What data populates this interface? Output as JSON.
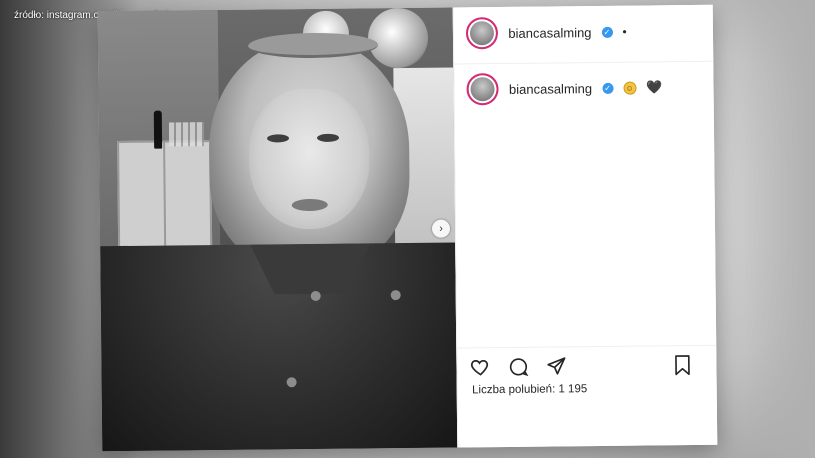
{
  "overlay": {
    "source_text": "źródło: instagram.com/biancasalming"
  },
  "post": {
    "author": {
      "username": "biancasalming",
      "verified": true,
      "header_dot": "•"
    },
    "caption": {
      "username": "biancasalming",
      "emojis": [
        "smiling-face-emoji",
        "black-heart-emoji"
      ],
      "heart_glyph": "🖤",
      "smile_glyph": "☺"
    },
    "carousel": {
      "next_icon": "chevron-right-icon",
      "glyph": "›"
    },
    "actions": {
      "like_icon": "heart-outline-icon",
      "comment_icon": "comment-bubble-icon",
      "share_icon": "paper-plane-icon",
      "save_icon": "bookmark-icon"
    },
    "likes_text": "Liczba polubień: 1 195"
  },
  "colors": {
    "verified": "#3897f0",
    "avatar_ring": "#d62976",
    "text": "#262626"
  }
}
